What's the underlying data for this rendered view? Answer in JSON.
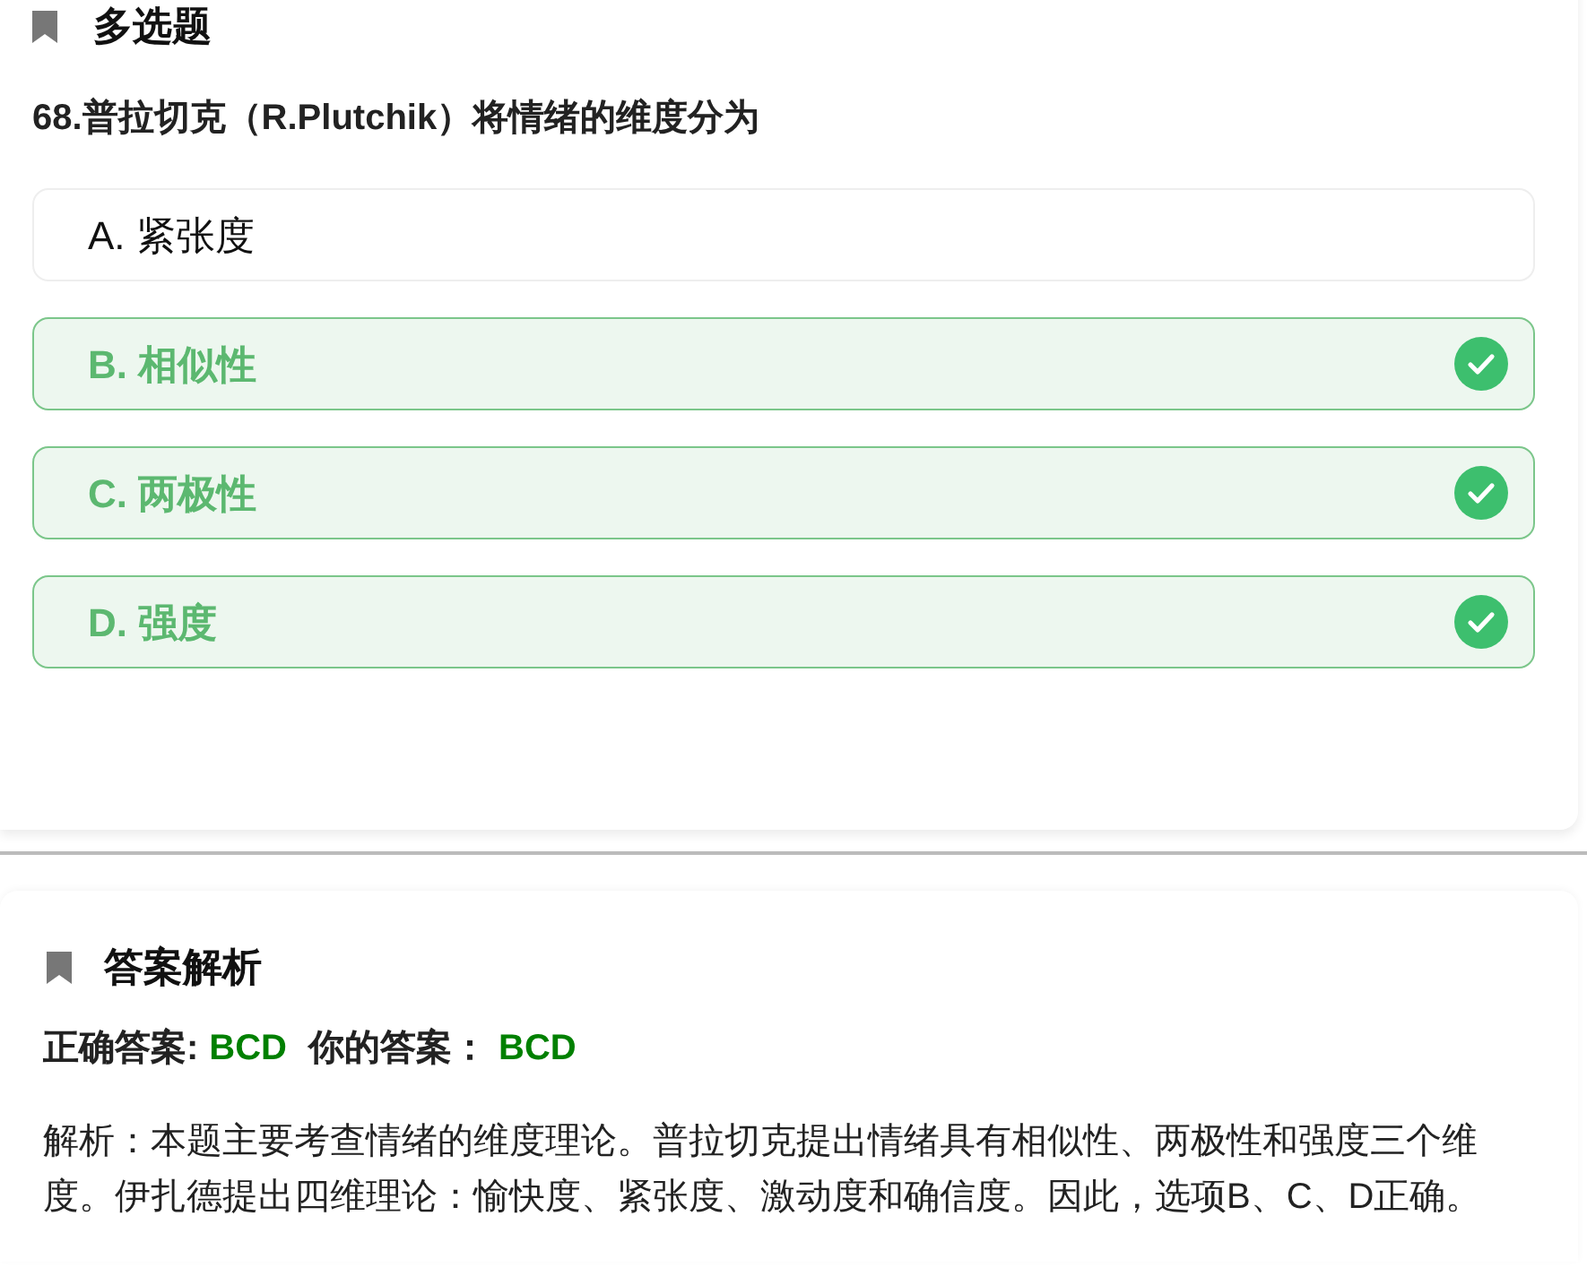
{
  "question_card": {
    "section_title": "多选题",
    "question": "68.普拉切克（R.Plutchik）将情绪的维度分为",
    "options": [
      {
        "label": "A. 紧张度",
        "selected": false
      },
      {
        "label": "B. 相似性",
        "selected": true
      },
      {
        "label": "C. 两极性",
        "selected": true
      },
      {
        "label": "D. 强度",
        "selected": true
      }
    ]
  },
  "analysis_card": {
    "section_title": "答案解析",
    "correct_answer_label": "正确答案:",
    "correct_answer": "BCD",
    "your_answer_label": "你的答案：",
    "your_answer": "BCD",
    "explanation": "解析：本题主要考查情绪的维度理论。普拉切克提出情绪具有相似性、两极性和强度三个维度。伊扎德提出四维理论：愉快度、紧张度、激动度和确信度。因此，选项B、C、D正确。"
  }
}
